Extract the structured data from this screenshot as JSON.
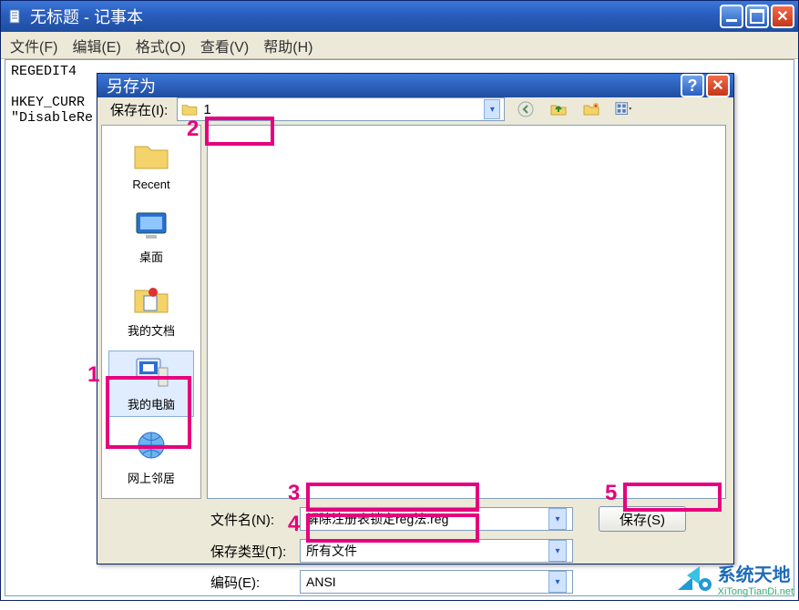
{
  "notepad": {
    "title": "无标题 - 记事本",
    "menu": {
      "file": "文件(F)",
      "edit": "编辑(E)",
      "format": "格式(O)",
      "view": "查看(V)",
      "help": "帮助(H)"
    },
    "body_line1": "REGEDIT4",
    "body_line2": "HKEY_CURR",
    "body_line3": "\"DisableRe"
  },
  "saveas": {
    "title": "另存为",
    "lookin_label": "保存在(I):",
    "lookin_value": "1",
    "places": {
      "recent": "Recent",
      "desktop": "桌面",
      "mydocs": "我的文档",
      "mycomputer": "我的电脑",
      "network": "网上邻居"
    },
    "filename_label": "文件名(N):",
    "filename_value": "解除注册表锁定reg法.reg",
    "filetype_label": "保存类型(T):",
    "filetype_value": "所有文件",
    "encoding_label": "编码(E):",
    "encoding_value": "ANSI",
    "save_btn": "保存(S)"
  },
  "annotations": {
    "n1": "1",
    "n2": "2",
    "n3": "3",
    "n4": "4",
    "n5": "5"
  },
  "watermark": {
    "brand": "系统天地",
    "url": "XiTongTianDi.net"
  }
}
